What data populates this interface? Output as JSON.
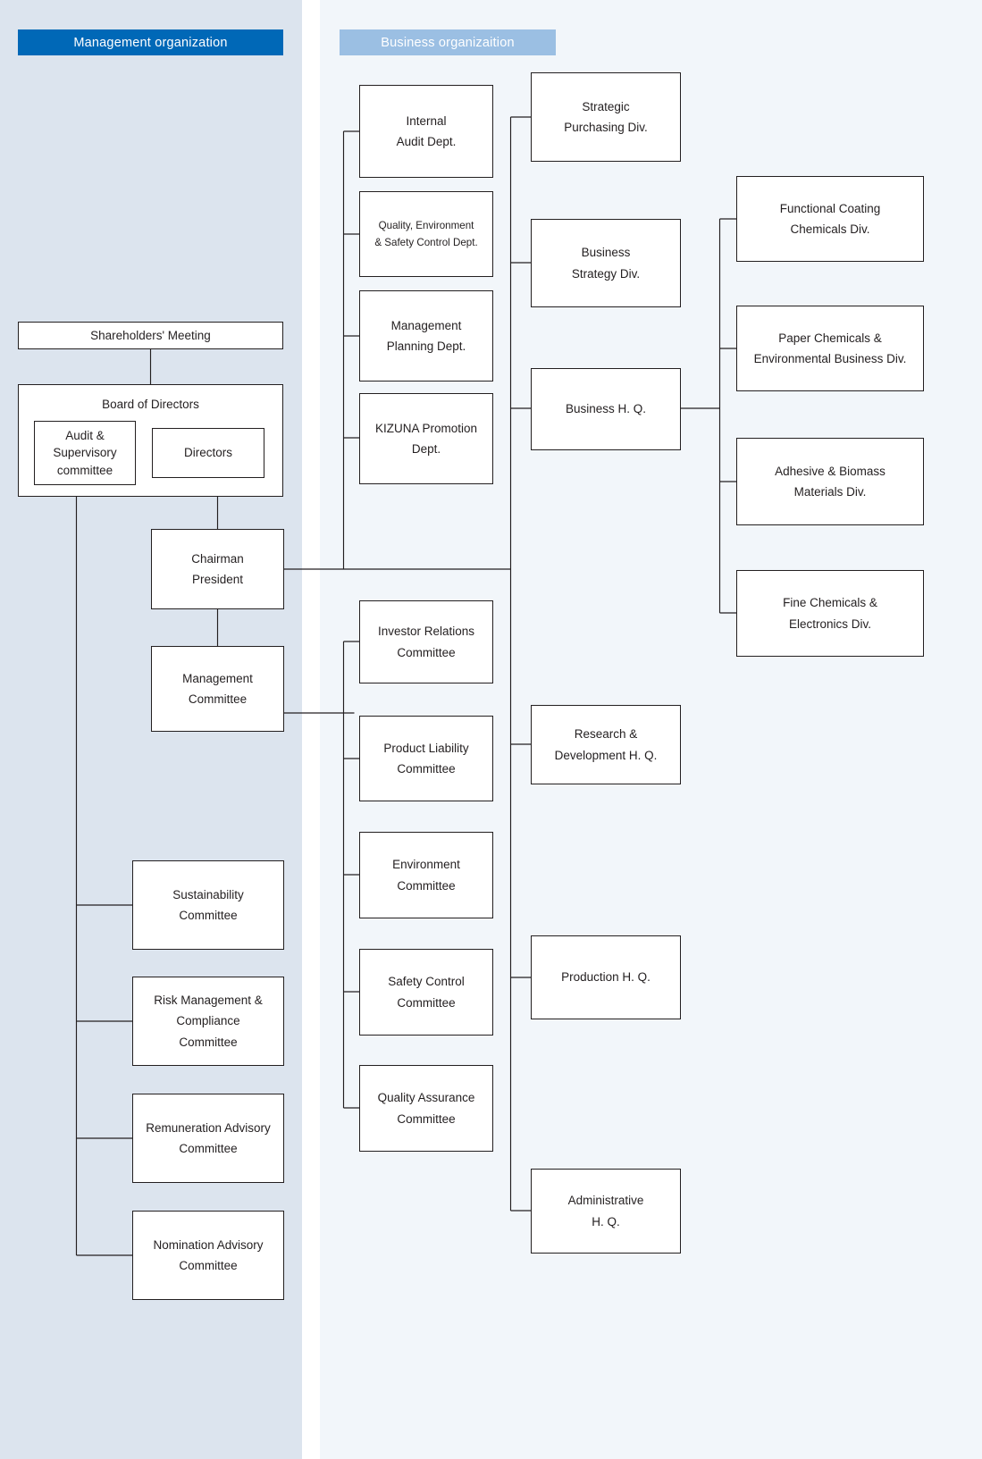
{
  "sections": {
    "management": {
      "label": "Management organization",
      "color": "#0068b7"
    },
    "business": {
      "label": "Business organizaition",
      "color": "#9bbfe3"
    }
  },
  "nodes": {
    "shareholders_meeting": "Shareholders' Meeting",
    "board_of_directors": "Board of Directors",
    "audit_supervisory_committee": "Audit &\nSupervisory\ncommittee",
    "directors": "Directors",
    "chairman_president": "Chairman\nPresident",
    "management_committee": "Management\nCommittee",
    "sustainability_committee": "Sustainability\nCommittee",
    "risk_management_compliance_committee": "Risk Management &\nCompliance\nCommittee",
    "remuneration_advisory_committee": "Remuneration Advisory\nCommittee",
    "nomination_advisory_committee": "Nomination Advisory\nCommittee",
    "internal_audit_dept": "Internal\nAudit Dept.",
    "quality_environment_safety_control_dept": "Quality, Environment\n& Safety Control Dept.",
    "management_planning_dept": "Management\nPlanning Dept.",
    "kizuna_promotion_dept": "KIZUNA Promotion\nDept.",
    "investor_relations_committee": "Investor Relations\nCommittee",
    "product_liability_committee": "Product Liability\nCommittee",
    "environment_committee": "Environment\nCommittee",
    "safety_control_committee": "Safety Control\nCommittee",
    "quality_assurance_committee": "Quality Assurance\nCommittee",
    "strategic_purchasing_div": "Strategic\nPurchasing Div.",
    "business_strategy_div": "Business\nStrategy Div.",
    "business_hq": "Business H. Q.",
    "research_development_hq": "Research &\nDevelopment H. Q.",
    "production_hq": "Production H. Q.",
    "administrative_hq": "Administrative\nH. Q.",
    "functional_coating_chemicals_div": "Functional Coating\nChemicals Div.",
    "paper_chemicals_environmental_business_div": "Paper Chemicals &\nEnvironmental Business Div.",
    "adhesive_biomass_materials_div": "Adhesive & Biomass\nMaterials Div.",
    "fine_chemicals_electronics_div": "Fine Chemicals &\nElectronics Div."
  },
  "colors": {
    "management_panel": "#dce4ee",
    "business_panel": "#f2f6fa",
    "box_border": "#231f20",
    "box_fill": "#ffffff",
    "text": "#231f20"
  }
}
